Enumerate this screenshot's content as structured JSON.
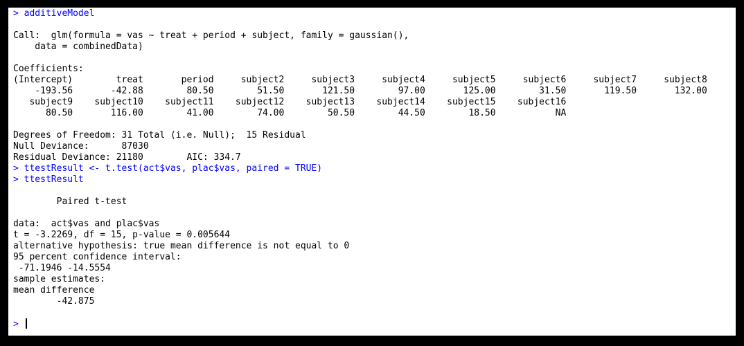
{
  "console": {
    "lines": [
      {
        "kind": "input",
        "text": "> additiveModel"
      },
      {
        "kind": "output",
        "text": ""
      },
      {
        "kind": "output",
        "text": "Call:  glm(formula = vas ~ treat + period + subject, family = gaussian(),"
      },
      {
        "kind": "output",
        "text": "    data = combinedData)"
      },
      {
        "kind": "output",
        "text": ""
      },
      {
        "kind": "output",
        "text": "Coefficients:"
      },
      {
        "kind": "output",
        "text": "(Intercept)        treat       period     subject2     subject3     subject4     subject5     subject6     subject7     subject8"
      },
      {
        "kind": "output",
        "text": "    -193.56       -42.88        80.50        51.50       121.50        97.00       125.00        31.50       119.50       132.00"
      },
      {
        "kind": "output",
        "text": "   subject9    subject10    subject11    subject12    subject13    subject14    subject15    subject16"
      },
      {
        "kind": "output",
        "text": "      80.50       116.00        41.00        74.00        50.50        44.50        18.50           NA"
      },
      {
        "kind": "output",
        "text": ""
      },
      {
        "kind": "output",
        "text": "Degrees of Freedom: 31 Total (i.e. Null);  15 Residual"
      },
      {
        "kind": "output",
        "text": "Null Deviance:      87030"
      },
      {
        "kind": "output",
        "text": "Residual Deviance: 21180        AIC: 334.7"
      },
      {
        "kind": "input",
        "text": "> ttestResult <- t.test(act$vas, plac$vas, paired = TRUE)"
      },
      {
        "kind": "input",
        "text": "> ttestResult"
      },
      {
        "kind": "output",
        "text": ""
      },
      {
        "kind": "output",
        "text": "        Paired t-test"
      },
      {
        "kind": "output",
        "text": ""
      },
      {
        "kind": "output",
        "text": "data:  act$vas and plac$vas"
      },
      {
        "kind": "output",
        "text": "t = -3.2269, df = 15, p-value = 0.005644"
      },
      {
        "kind": "output",
        "text": "alternative hypothesis: true mean difference is not equal to 0"
      },
      {
        "kind": "output",
        "text": "95 percent confidence interval:"
      },
      {
        "kind": "output",
        "text": " -71.1946 -14.5554"
      },
      {
        "kind": "output",
        "text": "sample estimates:"
      },
      {
        "kind": "output",
        "text": "mean difference"
      },
      {
        "kind": "output",
        "text": "        -42.875"
      },
      {
        "kind": "output",
        "text": ""
      },
      {
        "kind": "prompt",
        "text": "> "
      }
    ]
  },
  "colors": {
    "input": "#0000ff",
    "output": "#000000",
    "background": "#ffffff",
    "frame": "#000000"
  }
}
